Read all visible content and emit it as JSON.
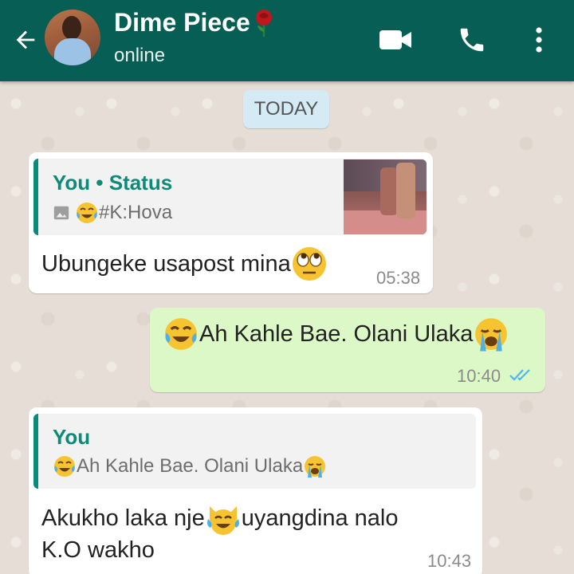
{
  "header": {
    "contact_name": "Dime Piece",
    "contact_name_emoji": "rose-icon",
    "status": "online",
    "icons": [
      "back-arrow-icon",
      "video-call-icon",
      "phone-icon",
      "more-vert-icon"
    ],
    "color": "#075e54"
  },
  "chat": {
    "date_separator": "TODAY",
    "messages": [
      {
        "direction": "incoming",
        "quote": {
          "title": "You • Status",
          "icon": "photo-icon",
          "emoji": "face-with-tears-of-joy-icon",
          "text": "#K:Hova",
          "thumbnail": "status-thumbnail-image"
        },
        "text": "Ubungeke usapost mina",
        "trailing_emoji": "face-with-rolling-eyes-icon",
        "time": "05:38"
      },
      {
        "direction": "outgoing",
        "leading_emoji": "face-with-tears-of-joy-icon",
        "text": "Ah Kahle Bae. Olani Ulaka",
        "trailing_emoji": "loudly-crying-face-icon",
        "time": "10:40",
        "status_icon": "double-check-read-icon",
        "bubble_color": "#dcf8c6"
      },
      {
        "direction": "incoming",
        "quote": {
          "title": "You",
          "leading_emoji": "face-with-tears-of-joy-icon",
          "text": "Ah Kahle Bae. Olani Ulaka",
          "trailing_emoji": "loudly-crying-face-icon"
        },
        "text_line1_a": "Akukho laka nje",
        "inline_emoji": "cat-with-tears-of-joy-icon",
        "text_line1_b": "uyangdina nalo",
        "text_line2": "K.O wakho",
        "time": "10:43"
      }
    ]
  }
}
